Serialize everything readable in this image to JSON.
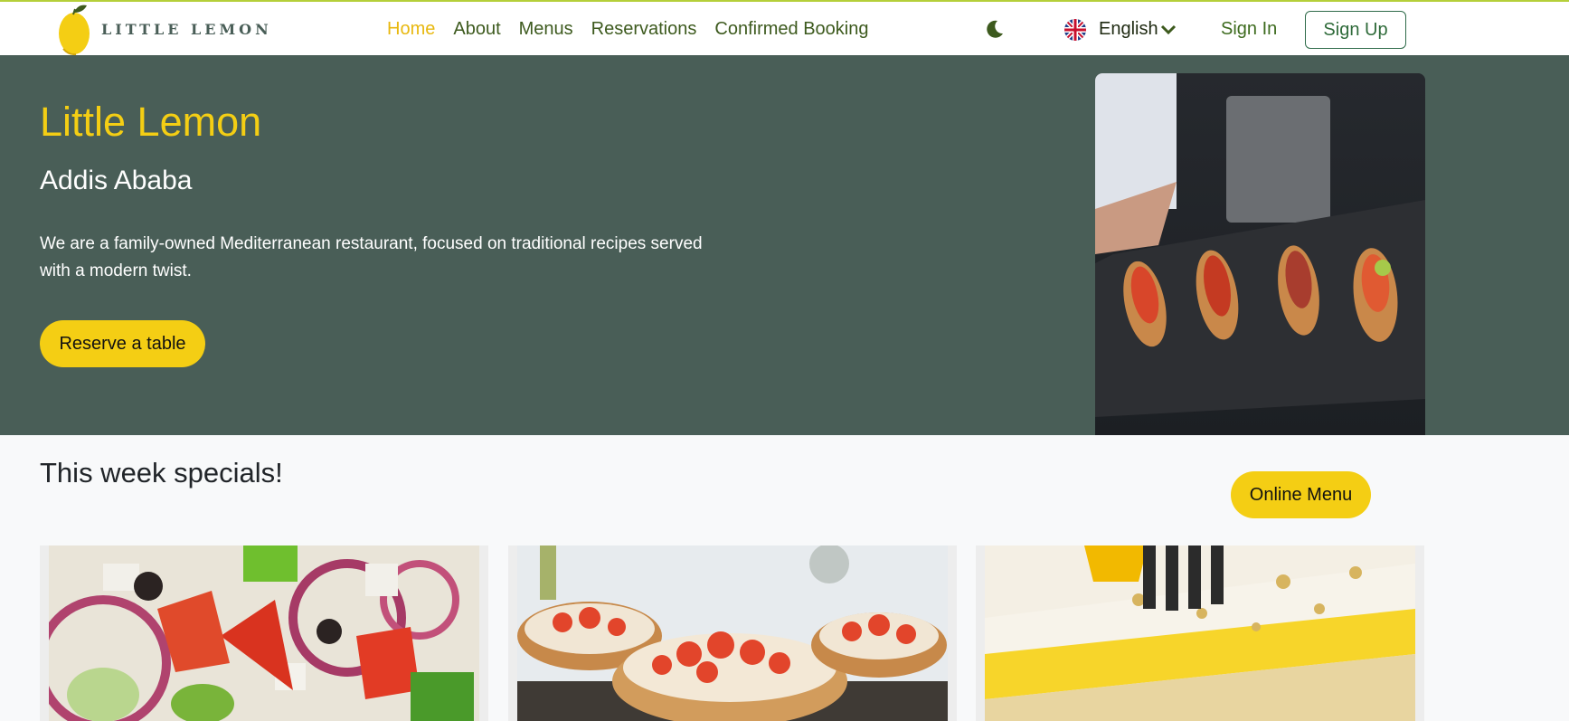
{
  "nav": {
    "logo_text": "LITTLE LEMON",
    "links": [
      {
        "label": "Home",
        "active": true
      },
      {
        "label": "About"
      },
      {
        "label": "Menus"
      },
      {
        "label": "Reservations"
      },
      {
        "label": "Confirmed Booking"
      }
    ],
    "theme_icon": "moon-icon",
    "language": {
      "label": "English",
      "icon": "uk-flag-icon"
    },
    "sign_in": "Sign In",
    "sign_up": "Sign Up"
  },
  "hero": {
    "title": "Little Lemon",
    "subtitle": "Addis Ababa",
    "description": "We are a family-owned Mediterranean restaurant, focused on traditional recipes served with a modern twist.",
    "cta": "Reserve a table",
    "image": "chef-holding-bruschetta-platter"
  },
  "specials": {
    "title": "This week specials!",
    "menu_button": "Online Menu",
    "cards": [
      {
        "image": "greek-salad"
      },
      {
        "image": "bruschetta"
      },
      {
        "image": "lemon-dessert"
      }
    ]
  },
  "colors": {
    "primary_green": "#495e57",
    "primary_yellow": "#f4ce14",
    "nav_text": "#3d5a1e",
    "background": "#f8f9fa"
  }
}
